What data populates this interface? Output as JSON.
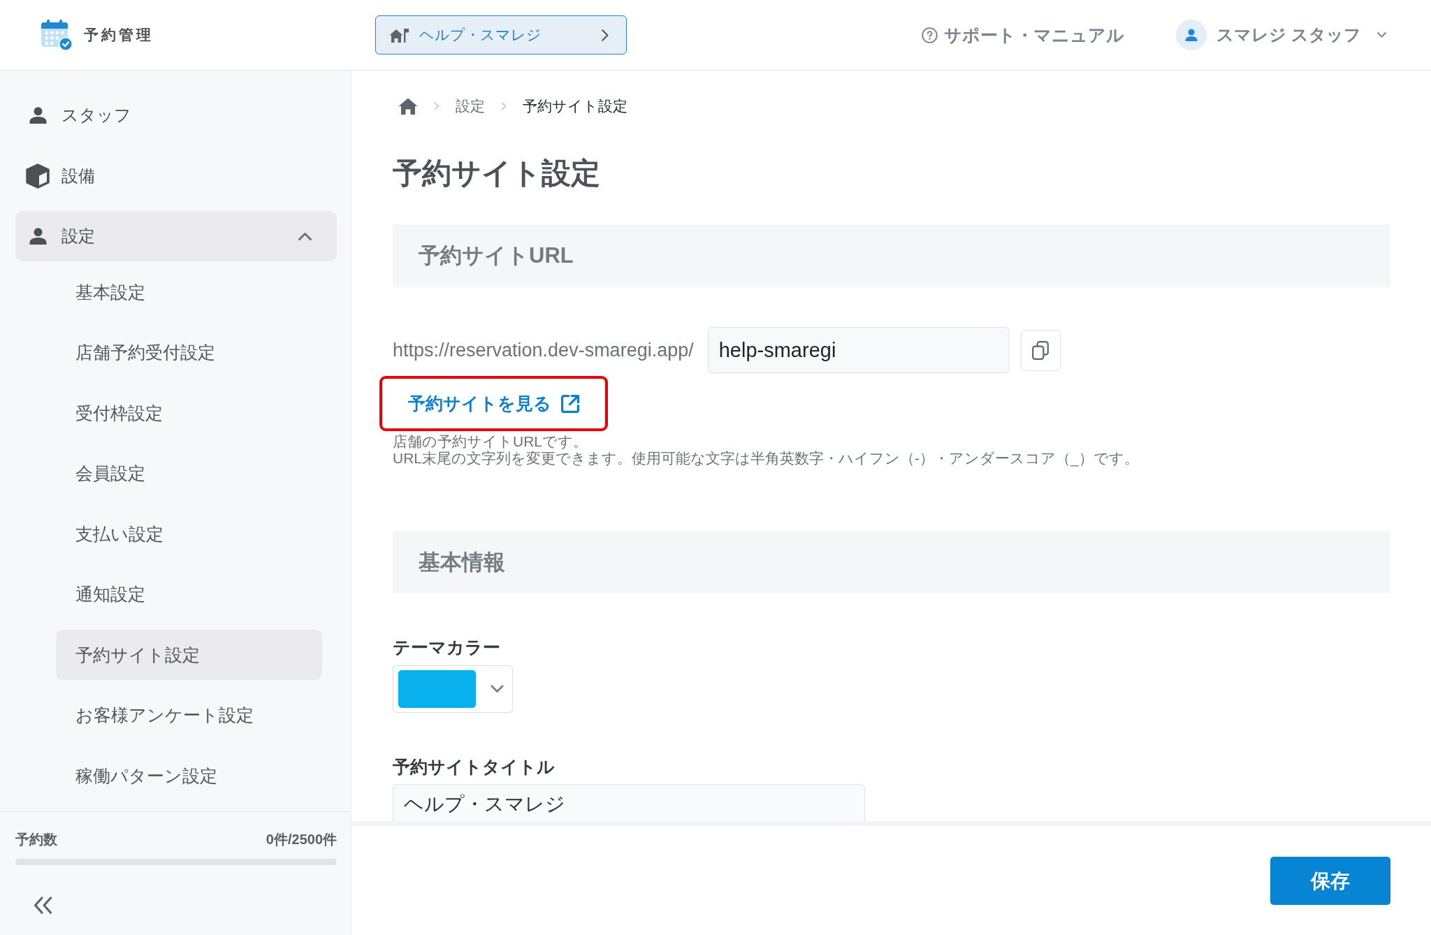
{
  "header": {
    "app_title": "予約管理",
    "help_button": "ヘルプ・スマレジ",
    "support_link": "サポート・マニュアル",
    "user_name": "スマレジ スタッフ"
  },
  "sidebar": {
    "items": [
      {
        "label": "スタッフ",
        "selected": false,
        "expanded": false
      },
      {
        "label": "設備",
        "selected": false,
        "expanded": false
      },
      {
        "label": "設定",
        "selected": true,
        "expanded": true,
        "children": [
          {
            "label": "基本設定",
            "selected": false
          },
          {
            "label": "店舗予約受付設定",
            "selected": false
          },
          {
            "label": "受付枠設定",
            "selected": false
          },
          {
            "label": "会員設定",
            "selected": false
          },
          {
            "label": "支払い設定",
            "selected": false
          },
          {
            "label": "通知設定",
            "selected": false
          },
          {
            "label": "予約サイト設定",
            "selected": true
          },
          {
            "label": "お客様アンケート設定",
            "selected": false
          },
          {
            "label": "稼働パターン設定",
            "selected": false
          }
        ]
      }
    ],
    "usage": {
      "label": "予約数",
      "value": "0件/2500件",
      "level": 0
    }
  },
  "breadcrumb": [
    "設定",
    "予約サイト設定"
  ],
  "page_title": "予約サイト設定",
  "url_section": {
    "heading": "予約サイトURL",
    "url_prefix": "https://reservation.dev-smaregi.app/",
    "slug": "help-smaregi",
    "view_link": {
      "label": "予約サイトを見る",
      "highlighted": true
    },
    "help_lines": [
      "店舗の予約サイトURLです。",
      "URL末尾の文字列を変更できます。使用可能な文字は半角英数字・ハイフン（-）・アンダースコア（_）です。"
    ]
  },
  "basic_section": {
    "heading": "基本情報",
    "theme_color": {
      "label": "テーマカラー",
      "color": "#08b1ee"
    },
    "site_title": {
      "label": "予約サイトタイトル",
      "value": "ヘルプ・スマレジ"
    }
  },
  "footer": {
    "save_button": "保存"
  }
}
